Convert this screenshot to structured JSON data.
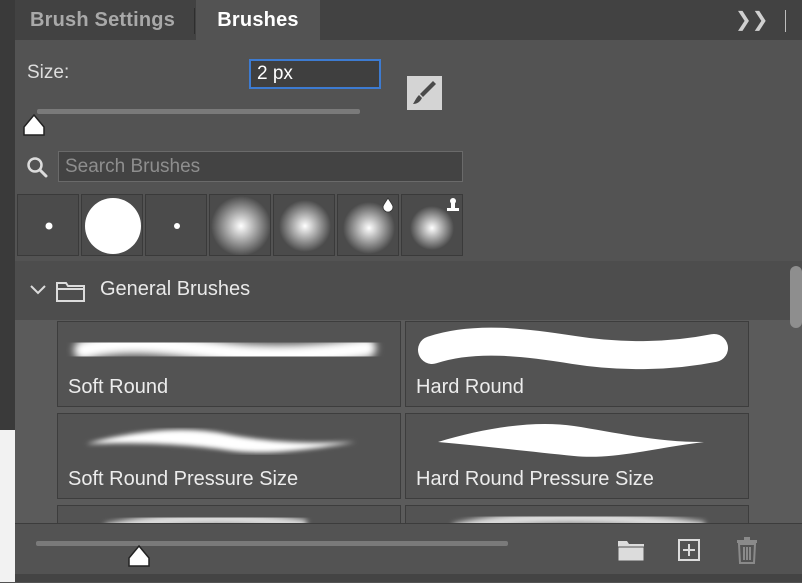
{
  "tabs": {
    "inactive_label": "Brush Settings",
    "active_label": "Brushes",
    "menu_glyph": "❯❯"
  },
  "size": {
    "label": "Size:",
    "value": "2 px",
    "slider_fraction": 0.0
  },
  "search": {
    "placeholder": "Search Brushes",
    "value": ""
  },
  "recent_presets": [
    {
      "kind": "hard-small",
      "badge": ""
    },
    {
      "kind": "hard-large",
      "badge": ""
    },
    {
      "kind": "hard-tiny",
      "badge": ""
    },
    {
      "kind": "soft-large",
      "badge": ""
    },
    {
      "kind": "soft-medium",
      "badge": ""
    },
    {
      "kind": "soft-wet",
      "badge": "droplet-icon"
    },
    {
      "kind": "soft-stamp",
      "badge": "stamp-icon"
    }
  ],
  "group": {
    "label": "General Brushes",
    "expanded": true
  },
  "brushes": [
    {
      "label": "Soft Round",
      "stroke": "soft-round"
    },
    {
      "label": "Hard Round",
      "stroke": "hard-round"
    },
    {
      "label": "Soft Round Pressure Size",
      "stroke": "soft-pressure"
    },
    {
      "label": "Hard Round Pressure Size",
      "stroke": "hard-pressure"
    }
  ],
  "bottom": {
    "preview_size_fraction": 0.22,
    "icons": [
      "folder-icon",
      "new-brush-icon",
      "trash-icon"
    ]
  },
  "colors": {
    "panel": "#535353",
    "focus_accent": "#3d7bd1"
  }
}
